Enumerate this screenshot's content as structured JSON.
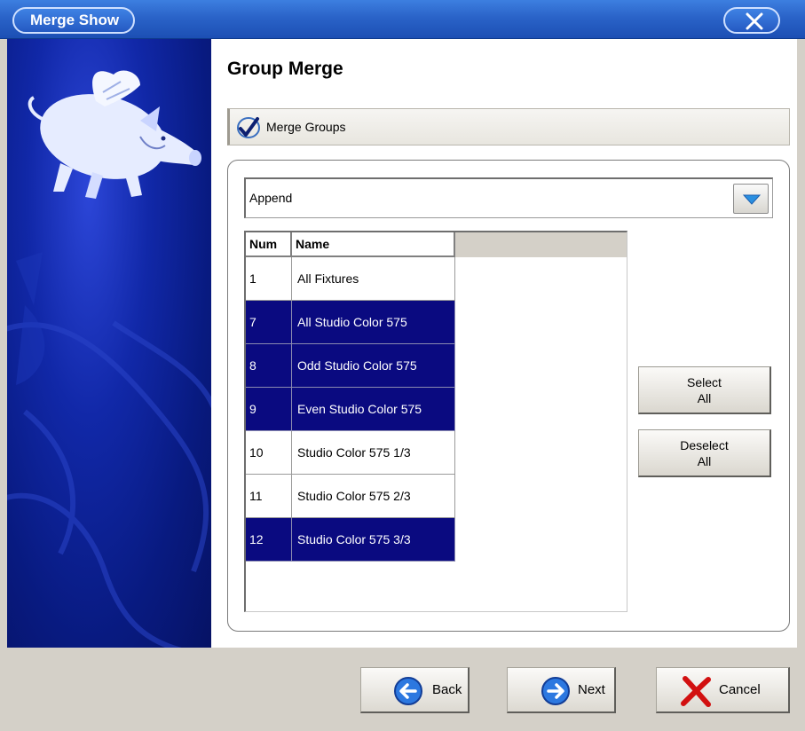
{
  "window": {
    "title": "Merge Show",
    "close_icon": "close-x-icon"
  },
  "page": {
    "title": "Group Merge",
    "banner_label": "Merge Groups",
    "banner_icon": "checkmark-icon"
  },
  "mode_select": {
    "selected": "Append"
  },
  "table": {
    "columns": [
      "Num",
      "Name"
    ],
    "rows": [
      {
        "num": "1",
        "name": "All Fixtures",
        "selected": false
      },
      {
        "num": "7",
        "name": "All Studio Color 575",
        "selected": true
      },
      {
        "num": "8",
        "name": "Odd Studio Color 575",
        "selected": true
      },
      {
        "num": "9",
        "name": "Even Studio Color 575",
        "selected": true
      },
      {
        "num": "10",
        "name": "Studio Color 575 1/3",
        "selected": false
      },
      {
        "num": "11",
        "name": "Studio Color 575 2/3",
        "selected": false
      },
      {
        "num": "12",
        "name": "Studio Color 575 3/3",
        "selected": true
      }
    ]
  },
  "buttons": {
    "select_all_line1": "Select",
    "select_all_line2": "All",
    "deselect_all_line1": "Deselect",
    "deselect_all_line2": "All",
    "back": "Back",
    "next": "Next",
    "cancel": "Cancel"
  },
  "colors": {
    "selection": "#0a0a80",
    "titlebar": "#2a63c8",
    "side_panel": "#1128a8"
  }
}
